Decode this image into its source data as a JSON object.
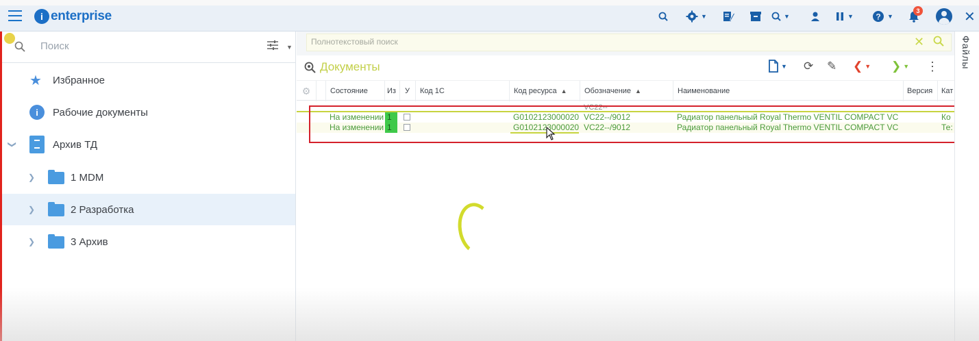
{
  "app": {
    "logo_text": "enterprise",
    "logo_mark": "i",
    "notification_count": "3"
  },
  "toolbar_icons": [
    "search-icon",
    "gear-icon",
    "edit-note-icon",
    "archive-icon",
    "search-dropdown-icon",
    "user-icon",
    "pause-icon",
    "help-icon",
    "bell-icon",
    "avatar-icon",
    "close-icon"
  ],
  "sidebar": {
    "search_placeholder": "Поиск",
    "items": [
      {
        "label": "Избранное"
      },
      {
        "label": "Рабочие документы"
      },
      {
        "label": "Архив ТД"
      },
      {
        "label": "1 MDM"
      },
      {
        "label": "2 Разработка"
      },
      {
        "label": "3 Архив"
      }
    ]
  },
  "fulltext": {
    "placeholder": "Полнотекстовый поиск"
  },
  "documents": {
    "title": "Документы",
    "columns": [
      {
        "label": "Состояние"
      },
      {
        "label": "Из"
      },
      {
        "label": "У"
      },
      {
        "label": "Код 1С"
      },
      {
        "label": "Код ресурса"
      },
      {
        "label": "Обозначение"
      },
      {
        "label": "Наименование"
      },
      {
        "label": "Версия"
      },
      {
        "label": "Кат"
      }
    ],
    "ghost_text": "VC22--",
    "rows": [
      {
        "state": "На изменении",
        "iz": "1",
        "code1c": "",
        "resource": "G0102123000020",
        "designation": "VC22--/9012",
        "name": "Радиатор панельный Royal Thermo VENTIL COMPACT VC",
        "version": "",
        "cat": "Ко"
      },
      {
        "state": "На изменении",
        "iz": "1",
        "code1c": "",
        "resource": "G0102123000020",
        "designation": "VC22--/9012",
        "name": "Радиатор панельный Royal Thermo VENTIL COMPACT VC",
        "version": "",
        "cat": "Те:"
      }
    ]
  },
  "right_tab": {
    "label": "Файлы"
  },
  "colors": {
    "brand": "#1c6fc6",
    "accent_yellow_green": "#c3d04a",
    "highlight_border": "#d4212b",
    "state_green": "#4a9a3a"
  }
}
